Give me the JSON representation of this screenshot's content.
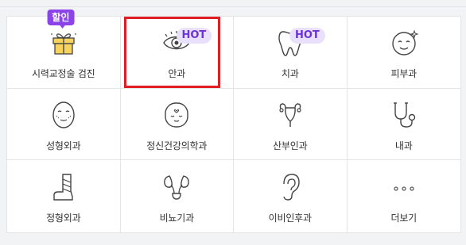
{
  "badges": {
    "hot": "HOT",
    "sale": "할인"
  },
  "departments": [
    {
      "label": "시력교정술 검진",
      "icon": "gift-icon",
      "badge": "할인"
    },
    {
      "label": "안과",
      "icon": "eye-icon",
      "badge": "HOT"
    },
    {
      "label": "치과",
      "icon": "tooth-icon",
      "badge": "HOT"
    },
    {
      "label": "피부과",
      "icon": "skin-face-icon"
    },
    {
      "label": "성형외과",
      "icon": "face-mesh-icon"
    },
    {
      "label": "정신건강의학과",
      "icon": "calm-face-icon"
    },
    {
      "label": "산부인과",
      "icon": "uterus-icon"
    },
    {
      "label": "내과",
      "icon": "stethoscope-icon"
    },
    {
      "label": "정형외과",
      "icon": "cast-leg-icon"
    },
    {
      "label": "비뇨기과",
      "icon": "kidney-icon"
    },
    {
      "label": "이비인후과",
      "icon": "ear-icon"
    },
    {
      "label": "더보기",
      "icon": "more-dots-icon"
    }
  ],
  "colors": {
    "accent": "#8a44e8",
    "hot_text": "#6a34d6",
    "hot_bg": "#e9e0fb",
    "highlight": "#e01e24"
  }
}
